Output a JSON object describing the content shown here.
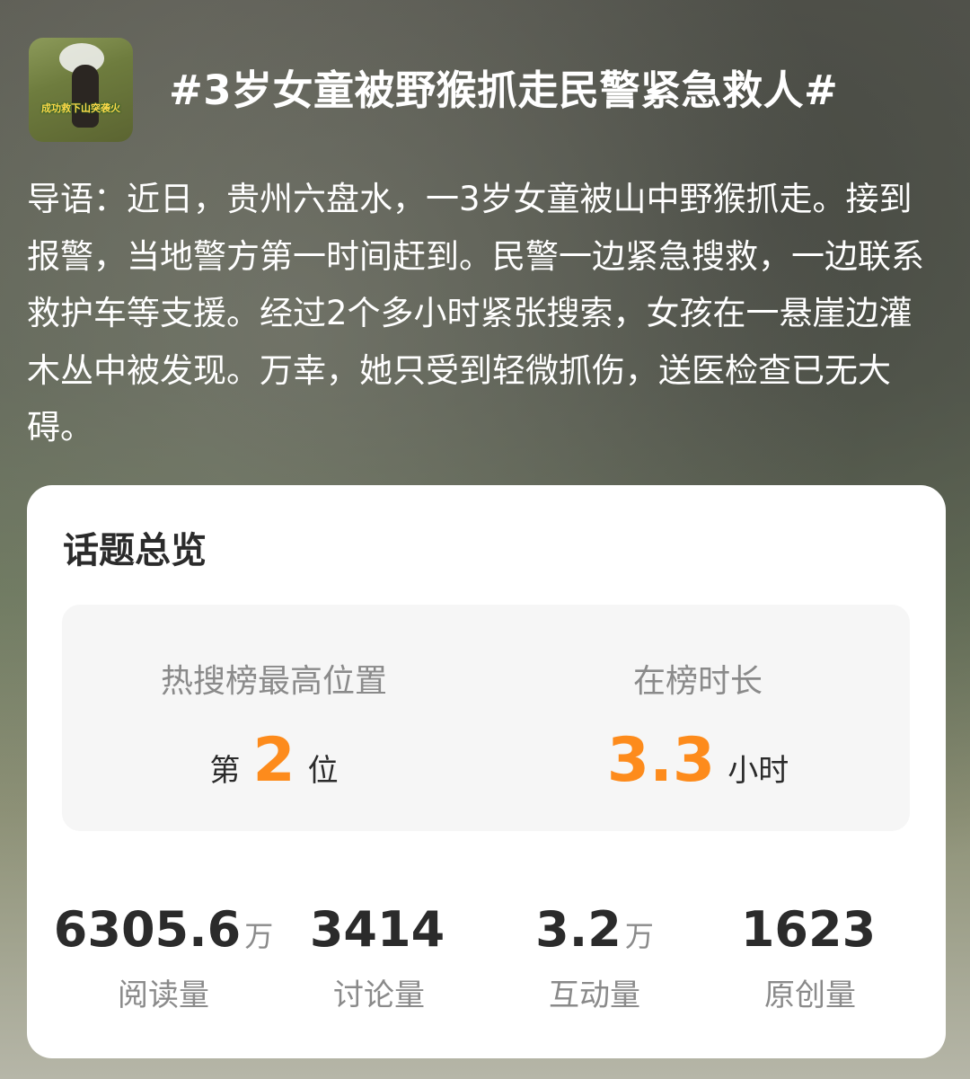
{
  "header": {
    "thumbnail_caption": "成功救下山突袭火",
    "title": "#3岁女童被野猴抓走民警紧急救人#"
  },
  "intro": {
    "text": "导语：近日，贵州六盘水，一3岁女童被山中野猴抓走。接到报警，当地警方第一时间赶到。民警一边紧急搜救，一边联系救护车等支援。经过2个多小时紧张搜索，女孩在一悬崖边灌木丛中被发现。万幸，她只受到轻微抓伤，送医检查已无大碍。"
  },
  "overview": {
    "title": "话题总览",
    "highest_rank": {
      "label": "热搜榜最高位置",
      "prefix": "第",
      "value": "2",
      "suffix": "位"
    },
    "duration": {
      "label": "在榜时长",
      "value": "3.3",
      "unit": "小时"
    },
    "stats": [
      {
        "value": "6305.6",
        "unit": "万",
        "label": "阅读量"
      },
      {
        "value": "3414",
        "unit": "",
        "label": "讨论量"
      },
      {
        "value": "3.2",
        "unit": "万",
        "label": "互动量"
      },
      {
        "value": "1623",
        "unit": "",
        "label": "原创量"
      }
    ]
  },
  "colors": {
    "accent": "#fd8b1c",
    "title_text": "#ffffff",
    "muted_text": "#8a8a8a",
    "dark_text": "#2b2b2b"
  }
}
